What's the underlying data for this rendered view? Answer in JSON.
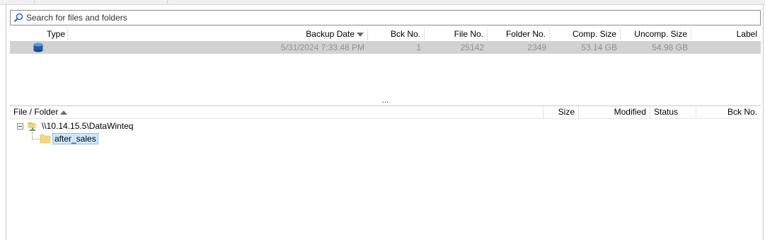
{
  "search": {
    "placeholder": "Search for files and folders"
  },
  "backups_table": {
    "columns": {
      "type": "Type",
      "backup_date": "Backup Date",
      "bck_no": "Bck No.",
      "file_no": "File No.",
      "folder_no": "Folder No.",
      "comp_size": "Comp. Size",
      "uncomp_size": "Uncomp. Size",
      "label": "Label"
    },
    "sort": {
      "column": "Backup Date",
      "direction": "descending"
    },
    "rows": [
      {
        "type_icon": "database-icon",
        "backup_date": "5/31/2024 7:33:48 PM",
        "bck_no": "1",
        "file_no": "25142",
        "folder_no": "2349",
        "comp_size": "53.14 GB",
        "uncomp_size": "54.98 GB",
        "label": ""
      }
    ]
  },
  "splitter": {
    "glyph": "..."
  },
  "files_table": {
    "columns": {
      "file_folder": "File / Folder",
      "size": "Size",
      "modified": "Modified",
      "status": "Status",
      "bck_no": "Bck No."
    },
    "sort": {
      "column": "File / Folder",
      "direction": "ascending"
    },
    "tree": {
      "root": {
        "label": "\\\\10.14.15.5\\DataWinteq",
        "icon": "network-folder-icon",
        "expanded": true
      },
      "children": [
        {
          "label": "after_sales",
          "icon": "folder-icon",
          "selected": true
        }
      ]
    }
  },
  "colors": {
    "selected_row": "#d2d2d2",
    "selected_row_text": "#8f8f8f",
    "tree_selection": "#cce8ff",
    "folder_yellow": "#f8d775",
    "database_blue": "#1e5aa8"
  }
}
